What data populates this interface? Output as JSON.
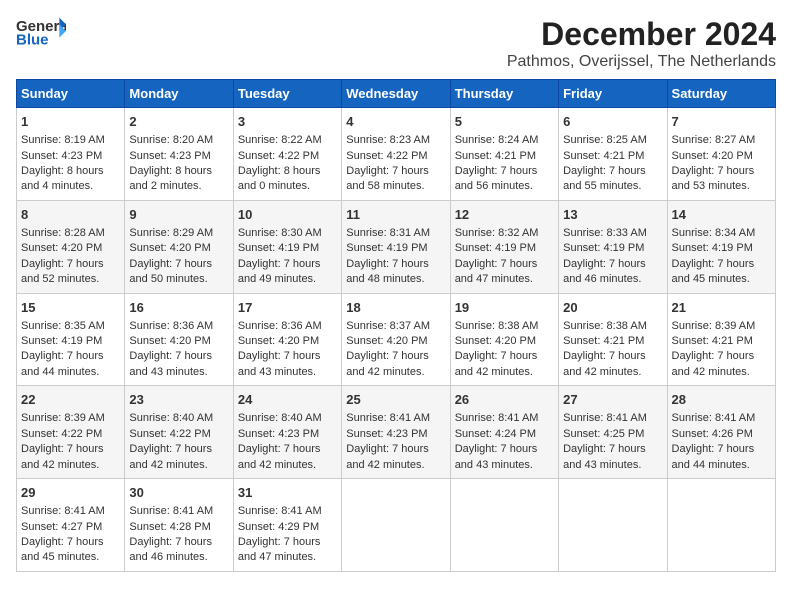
{
  "header": {
    "logo_line1": "General",
    "logo_line2": "Blue",
    "title": "December 2024",
    "subtitle": "Pathmos, Overijssel, The Netherlands"
  },
  "days_of_week": [
    "Sunday",
    "Monday",
    "Tuesday",
    "Wednesday",
    "Thursday",
    "Friday",
    "Saturday"
  ],
  "weeks": [
    [
      {
        "day": "1",
        "info": "Sunrise: 8:19 AM\nSunset: 4:23 PM\nDaylight: 8 hours\nand 4 minutes."
      },
      {
        "day": "2",
        "info": "Sunrise: 8:20 AM\nSunset: 4:23 PM\nDaylight: 8 hours\nand 2 minutes."
      },
      {
        "day": "3",
        "info": "Sunrise: 8:22 AM\nSunset: 4:22 PM\nDaylight: 8 hours\nand 0 minutes."
      },
      {
        "day": "4",
        "info": "Sunrise: 8:23 AM\nSunset: 4:22 PM\nDaylight: 7 hours\nand 58 minutes."
      },
      {
        "day": "5",
        "info": "Sunrise: 8:24 AM\nSunset: 4:21 PM\nDaylight: 7 hours\nand 56 minutes."
      },
      {
        "day": "6",
        "info": "Sunrise: 8:25 AM\nSunset: 4:21 PM\nDaylight: 7 hours\nand 55 minutes."
      },
      {
        "day": "7",
        "info": "Sunrise: 8:27 AM\nSunset: 4:20 PM\nDaylight: 7 hours\nand 53 minutes."
      }
    ],
    [
      {
        "day": "8",
        "info": "Sunrise: 8:28 AM\nSunset: 4:20 PM\nDaylight: 7 hours\nand 52 minutes."
      },
      {
        "day": "9",
        "info": "Sunrise: 8:29 AM\nSunset: 4:20 PM\nDaylight: 7 hours\nand 50 minutes."
      },
      {
        "day": "10",
        "info": "Sunrise: 8:30 AM\nSunset: 4:19 PM\nDaylight: 7 hours\nand 49 minutes."
      },
      {
        "day": "11",
        "info": "Sunrise: 8:31 AM\nSunset: 4:19 PM\nDaylight: 7 hours\nand 48 minutes."
      },
      {
        "day": "12",
        "info": "Sunrise: 8:32 AM\nSunset: 4:19 PM\nDaylight: 7 hours\nand 47 minutes."
      },
      {
        "day": "13",
        "info": "Sunrise: 8:33 AM\nSunset: 4:19 PM\nDaylight: 7 hours\nand 46 minutes."
      },
      {
        "day": "14",
        "info": "Sunrise: 8:34 AM\nSunset: 4:19 PM\nDaylight: 7 hours\nand 45 minutes."
      }
    ],
    [
      {
        "day": "15",
        "info": "Sunrise: 8:35 AM\nSunset: 4:19 PM\nDaylight: 7 hours\nand 44 minutes."
      },
      {
        "day": "16",
        "info": "Sunrise: 8:36 AM\nSunset: 4:20 PM\nDaylight: 7 hours\nand 43 minutes."
      },
      {
        "day": "17",
        "info": "Sunrise: 8:36 AM\nSunset: 4:20 PM\nDaylight: 7 hours\nand 43 minutes."
      },
      {
        "day": "18",
        "info": "Sunrise: 8:37 AM\nSunset: 4:20 PM\nDaylight: 7 hours\nand 42 minutes."
      },
      {
        "day": "19",
        "info": "Sunrise: 8:38 AM\nSunset: 4:20 PM\nDaylight: 7 hours\nand 42 minutes."
      },
      {
        "day": "20",
        "info": "Sunrise: 8:38 AM\nSunset: 4:21 PM\nDaylight: 7 hours\nand 42 minutes."
      },
      {
        "day": "21",
        "info": "Sunrise: 8:39 AM\nSunset: 4:21 PM\nDaylight: 7 hours\nand 42 minutes."
      }
    ],
    [
      {
        "day": "22",
        "info": "Sunrise: 8:39 AM\nSunset: 4:22 PM\nDaylight: 7 hours\nand 42 minutes."
      },
      {
        "day": "23",
        "info": "Sunrise: 8:40 AM\nSunset: 4:22 PM\nDaylight: 7 hours\nand 42 minutes."
      },
      {
        "day": "24",
        "info": "Sunrise: 8:40 AM\nSunset: 4:23 PM\nDaylight: 7 hours\nand 42 minutes."
      },
      {
        "day": "25",
        "info": "Sunrise: 8:41 AM\nSunset: 4:23 PM\nDaylight: 7 hours\nand 42 minutes."
      },
      {
        "day": "26",
        "info": "Sunrise: 8:41 AM\nSunset: 4:24 PM\nDaylight: 7 hours\nand 43 minutes."
      },
      {
        "day": "27",
        "info": "Sunrise: 8:41 AM\nSunset: 4:25 PM\nDaylight: 7 hours\nand 43 minutes."
      },
      {
        "day": "28",
        "info": "Sunrise: 8:41 AM\nSunset: 4:26 PM\nDaylight: 7 hours\nand 44 minutes."
      }
    ],
    [
      {
        "day": "29",
        "info": "Sunrise: 8:41 AM\nSunset: 4:27 PM\nDaylight: 7 hours\nand 45 minutes."
      },
      {
        "day": "30",
        "info": "Sunrise: 8:41 AM\nSunset: 4:28 PM\nDaylight: 7 hours\nand 46 minutes."
      },
      {
        "day": "31",
        "info": "Sunrise: 8:41 AM\nSunset: 4:29 PM\nDaylight: 7 hours\nand 47 minutes."
      },
      {
        "day": "",
        "info": ""
      },
      {
        "day": "",
        "info": ""
      },
      {
        "day": "",
        "info": ""
      },
      {
        "day": "",
        "info": ""
      }
    ]
  ]
}
